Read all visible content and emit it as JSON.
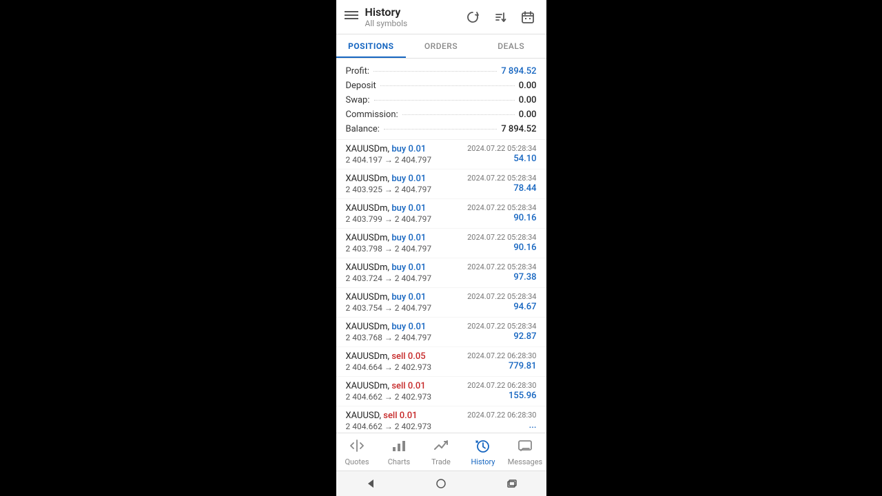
{
  "header": {
    "title": "History",
    "subtitle": "All symbols",
    "menu_icon": "☰",
    "icon_refresh": "↺",
    "icon_sort": "⇅",
    "icon_calendar": "📅"
  },
  "tabs": [
    {
      "label": "POSITIONS",
      "active": true
    },
    {
      "label": "ORDERS",
      "active": false
    },
    {
      "label": "DEALS",
      "active": false
    }
  ],
  "summary": [
    {
      "label": "Profit:",
      "value": "7 894.52",
      "blue": true
    },
    {
      "label": "Deposit",
      "value": "0.00",
      "blue": false
    },
    {
      "label": "Swap:",
      "value": "0.00",
      "blue": false
    },
    {
      "label": "Commission:",
      "value": "0.00",
      "blue": false
    },
    {
      "label": "Balance:",
      "value": "7 894.52",
      "blue": false
    }
  ],
  "trades": [
    {
      "symbol": "XAUUSDm,",
      "direction": "buy",
      "volume": "0.01",
      "price_from": "2 404.197",
      "price_to": "2 404.797",
      "date": "2024.07.22 05:28:34",
      "profit": "54.10"
    },
    {
      "symbol": "XAUUSDm,",
      "direction": "buy",
      "volume": "0.01",
      "price_from": "2 403.925",
      "price_to": "2 404.797",
      "date": "2024.07.22 05:28:34",
      "profit": "78.44"
    },
    {
      "symbol": "XAUUSDm,",
      "direction": "buy",
      "volume": "0.01",
      "price_from": "2 403.799",
      "price_to": "2 404.797",
      "date": "2024.07.22 05:28:34",
      "profit": "90.16"
    },
    {
      "symbol": "XAUUSDm,",
      "direction": "buy",
      "volume": "0.01",
      "price_from": "2 403.798",
      "price_to": "2 404.797",
      "date": "2024.07.22 05:28:34",
      "profit": "90.16"
    },
    {
      "symbol": "XAUUSDm,",
      "direction": "buy",
      "volume": "0.01",
      "price_from": "2 403.724",
      "price_to": "2 404.797",
      "date": "2024.07.22 05:28:34",
      "profit": "97.38"
    },
    {
      "symbol": "XAUUSDm,",
      "direction": "buy",
      "volume": "0.01",
      "price_from": "2 403.754",
      "price_to": "2 404.797",
      "date": "2024.07.22 05:28:34",
      "profit": "94.67"
    },
    {
      "symbol": "XAUUSDm,",
      "direction": "buy",
      "volume": "0.01",
      "price_from": "2 403.768",
      "price_to": "2 404.797",
      "date": "2024.07.22 05:28:34",
      "profit": "92.87"
    },
    {
      "symbol": "XAUUSDm,",
      "direction": "sell",
      "volume": "0.05",
      "price_from": "2 404.664",
      "price_to": "2 402.973",
      "date": "2024.07.22 06:28:30",
      "profit": "779.81"
    },
    {
      "symbol": "XAUUSDm,",
      "direction": "sell",
      "volume": "0.01",
      "price_from": "2 404.662",
      "price_to": "2 402.973",
      "date": "2024.07.22 06:28:30",
      "profit": "155.96"
    },
    {
      "symbol": "XAUUSD,",
      "direction": "sell",
      "volume": "0.01",
      "price_from": "2 404.662",
      "price_to": "2 402.973",
      "date": "2024.07.22 06:28:30",
      "profit": "..."
    }
  ],
  "bottom_nav": [
    {
      "label": "Quotes",
      "icon": "↑↓",
      "active": false
    },
    {
      "label": "Charts",
      "icon": "⊞",
      "active": false
    },
    {
      "label": "Trade",
      "icon": "📈",
      "active": false
    },
    {
      "label": "History",
      "icon": "🕐",
      "active": true
    },
    {
      "label": "Messages",
      "icon": "💬",
      "active": false
    }
  ]
}
